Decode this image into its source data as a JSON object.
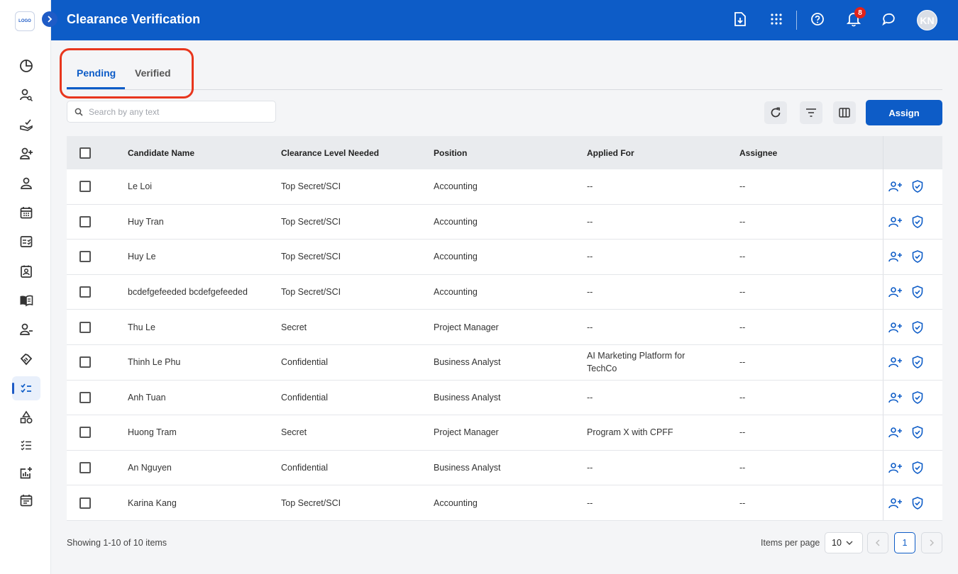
{
  "app": {
    "logo_text": "LOGO",
    "title": "Clearance Verification",
    "avatar_initials": "KN",
    "notification_count": "8"
  },
  "sidebar": {
    "items": [
      {
        "icon": "pie-chart-icon"
      },
      {
        "icon": "user-search-icon"
      },
      {
        "icon": "hand-check-icon"
      },
      {
        "icon": "user-plus-icon"
      },
      {
        "icon": "user-icon"
      },
      {
        "icon": "calendar-icon"
      },
      {
        "icon": "checklist-card-icon"
      },
      {
        "icon": "badge-id-icon"
      },
      {
        "icon": "book-icon"
      },
      {
        "icon": "user-minus-icon"
      },
      {
        "icon": "handshake-icon"
      },
      {
        "icon": "task-list-icon",
        "active": true
      },
      {
        "icon": "shapes-icon"
      },
      {
        "icon": "ordered-list-icon"
      },
      {
        "icon": "report-add-icon"
      },
      {
        "icon": "event-note-icon"
      }
    ]
  },
  "tabs": [
    {
      "label": "Pending",
      "active": true
    },
    {
      "label": "Verified"
    }
  ],
  "search": {
    "placeholder": "Search by any text"
  },
  "toolbar": {
    "assign_label": "Assign"
  },
  "table": {
    "columns": [
      "Candidate Name",
      "Clearance Level Needed",
      "Position",
      "Applied For",
      "Assignee"
    ],
    "rows": [
      {
        "name": "Le Loi",
        "level": "Top Secret/SCI",
        "position": "Accounting",
        "applied": "--",
        "assignee": "--"
      },
      {
        "name": "Huy Tran",
        "level": "Top Secret/SCI",
        "position": "Accounting",
        "applied": "--",
        "assignee": "--"
      },
      {
        "name": "Huy Le",
        "level": "Top Secret/SCI",
        "position": "Accounting",
        "applied": "--",
        "assignee": "--"
      },
      {
        "name": "bcdefgefeeded bcdefgefeeded",
        "level": "Top Secret/SCI",
        "position": "Accounting",
        "applied": "--",
        "assignee": "--"
      },
      {
        "name": "Thu Le",
        "level": "Secret",
        "position": "Project Manager",
        "applied": "--",
        "assignee": "--"
      },
      {
        "name": "Thinh Le Phu",
        "level": "Confidential",
        "position": "Business Analyst",
        "applied": "AI Marketing Platform for TechCo",
        "assignee": "--"
      },
      {
        "name": "Anh Tuan",
        "level": "Confidential",
        "position": "Business Analyst",
        "applied": "--",
        "assignee": "--"
      },
      {
        "name": "Huong Tram",
        "level": "Secret",
        "position": "Project Manager",
        "applied": "Program X with CPFF",
        "assignee": "--"
      },
      {
        "name": "An Nguyen",
        "level": "Confidential",
        "position": "Business Analyst",
        "applied": "--",
        "assignee": "--"
      },
      {
        "name": "Karina Kang",
        "level": "Top Secret/SCI",
        "position": "Accounting",
        "applied": "--",
        "assignee": "--"
      }
    ]
  },
  "footer": {
    "showing": "Showing 1-10 of 10 items",
    "items_per_page_label": "Items per page",
    "items_per_page": "10",
    "current_page": "1"
  },
  "colors": {
    "primary": "#0d5cc7",
    "badge": "#e2231a",
    "highlight": "#e8361d"
  }
}
